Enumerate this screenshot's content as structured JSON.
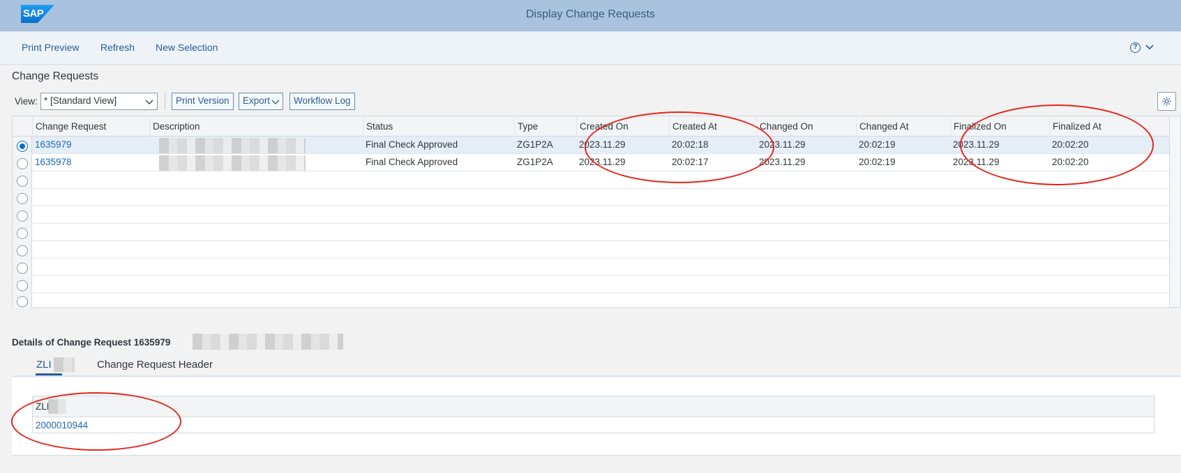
{
  "shell": {
    "logo_text": "SAP",
    "title": "Display Change Requests"
  },
  "toolbar": {
    "print_preview": "Print Preview",
    "refresh": "Refresh",
    "new_selection": "New Selection",
    "help_glyph": "?"
  },
  "section": {
    "title": "Change Requests"
  },
  "table_toolbar": {
    "view_label": "View:",
    "view_value": "* [Standard View]",
    "print_version": "Print Version",
    "export": "Export",
    "workflow_log": "Workflow Log"
  },
  "grid": {
    "columns": [
      "Change Request",
      "Description",
      "Status",
      "Type",
      "Created On",
      "Created At",
      "Changed On",
      "Changed At",
      "Finalized On",
      "Finalized At"
    ],
    "rows": [
      {
        "id": "1635979",
        "status": "Final Check Approved",
        "type": "ZG1P2A",
        "created_on": "2023.11.29",
        "created_at": "20:02:18",
        "changed_on": "2023.11.29",
        "changed_at": "20:02:19",
        "finalized_on": "2023.11.29",
        "finalized_at": "20:02:20"
      },
      {
        "id": "1635978",
        "status": "Final Check Approved",
        "type": "ZG1P2A",
        "created_on": "2023.11.29",
        "created_at": "20:02:17",
        "changed_on": "2023.11.29",
        "changed_at": "20:02:19",
        "finalized_on": "2023.11.29",
        "finalized_at": "20:02:20"
      }
    ]
  },
  "details": {
    "title": "Details of Change Request 1635979",
    "tabs": [
      "ZLI",
      "Change Request Header"
    ],
    "inner_header": "ZLI",
    "inner_value": "2000010944"
  },
  "colors": {
    "shell": "#a9c3de",
    "link": "#1b67b1",
    "annotation": "#e3261b"
  }
}
